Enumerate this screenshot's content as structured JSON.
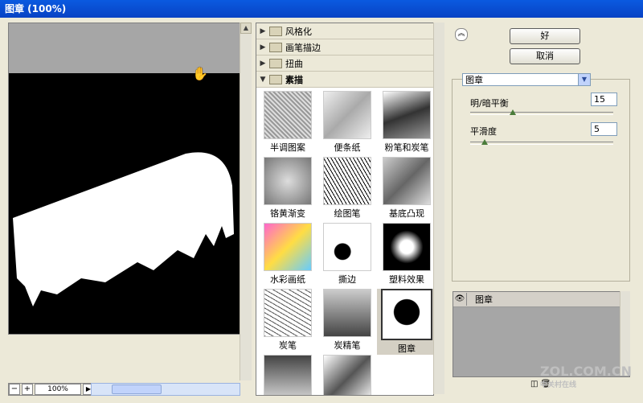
{
  "window": {
    "title": "图章  (100%)"
  },
  "preview": {
    "zoom": "100%",
    "minus": "−",
    "plus": "+"
  },
  "filter_groups": [
    {
      "label": "风格化",
      "expanded": false
    },
    {
      "label": "画笔描边",
      "expanded": false
    },
    {
      "label": "扭曲",
      "expanded": false
    },
    {
      "label": "素描",
      "expanded": true
    }
  ],
  "thumbnails": [
    {
      "label": "半调图案"
    },
    {
      "label": "便条纸"
    },
    {
      "label": "粉笔和炭笔"
    },
    {
      "label": "铬黄渐变"
    },
    {
      "label": "绘图笔"
    },
    {
      "label": "基底凸现"
    },
    {
      "label": "水彩画纸"
    },
    {
      "label": "撕边"
    },
    {
      "label": "塑料效果"
    },
    {
      "label": "炭笔"
    },
    {
      "label": "炭精笔"
    },
    {
      "label": "图章",
      "selected": true
    },
    {
      "label": ""
    },
    {
      "label": ""
    }
  ],
  "buttons": {
    "ok": "好",
    "cancel": "取消"
  },
  "settings": {
    "filter_select": "图章",
    "params": [
      {
        "label": "明/暗平衡",
        "value": "15",
        "level": 0.3
      },
      {
        "label": "平滑度",
        "value": "5",
        "level": 0.1
      }
    ]
  },
  "layers": [
    {
      "name": "图章",
      "eye_icon": "eye-icon"
    }
  ],
  "watermark": {
    "text": "ZOL.COM.CN",
    "sub": "中关村在线"
  }
}
